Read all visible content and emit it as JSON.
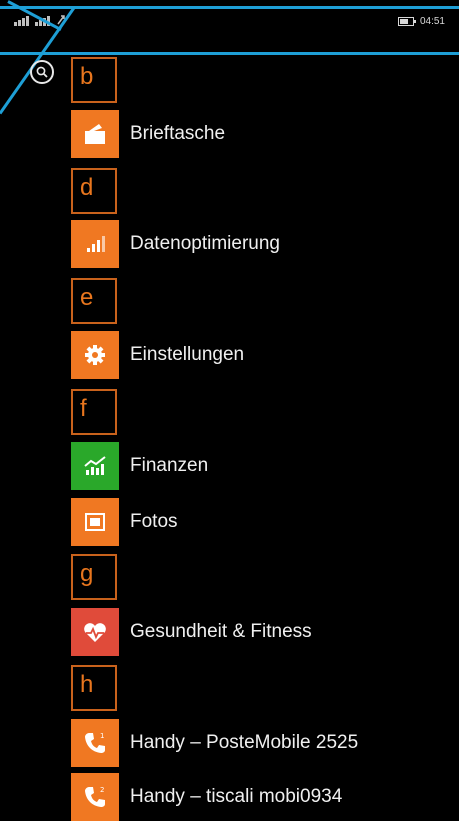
{
  "status": {
    "time": "04:51"
  },
  "groups": [
    {
      "letter": "b",
      "apps": [
        {
          "name": "Brieftasche",
          "icon": "wallet-icon"
        }
      ]
    },
    {
      "letter": "d",
      "apps": [
        {
          "name": "Datenoptimierung",
          "icon": "data-sense-icon"
        }
      ]
    },
    {
      "letter": "e",
      "apps": [
        {
          "name": "Einstellungen",
          "icon": "gear-icon"
        }
      ]
    },
    {
      "letter": "f",
      "apps": [
        {
          "name": "Finanzen",
          "icon": "finance-chart-icon"
        },
        {
          "name": "Fotos",
          "icon": "photos-icon"
        }
      ]
    },
    {
      "letter": "g",
      "apps": [
        {
          "name": "Gesundheit & Fitness",
          "icon": "heart-pulse-icon"
        }
      ]
    },
    {
      "letter": "h",
      "apps": [
        {
          "name": "Handy – PosteMobile 2525",
          "icon": "phone-icon"
        },
        {
          "name": "Handy – tiscali mobi0934",
          "icon": "phone-icon"
        }
      ]
    }
  ],
  "colors": {
    "accent": "#f07822",
    "finance": "#2aa82a",
    "health": "#e04b3a",
    "annotation": "#1e9fd6"
  }
}
